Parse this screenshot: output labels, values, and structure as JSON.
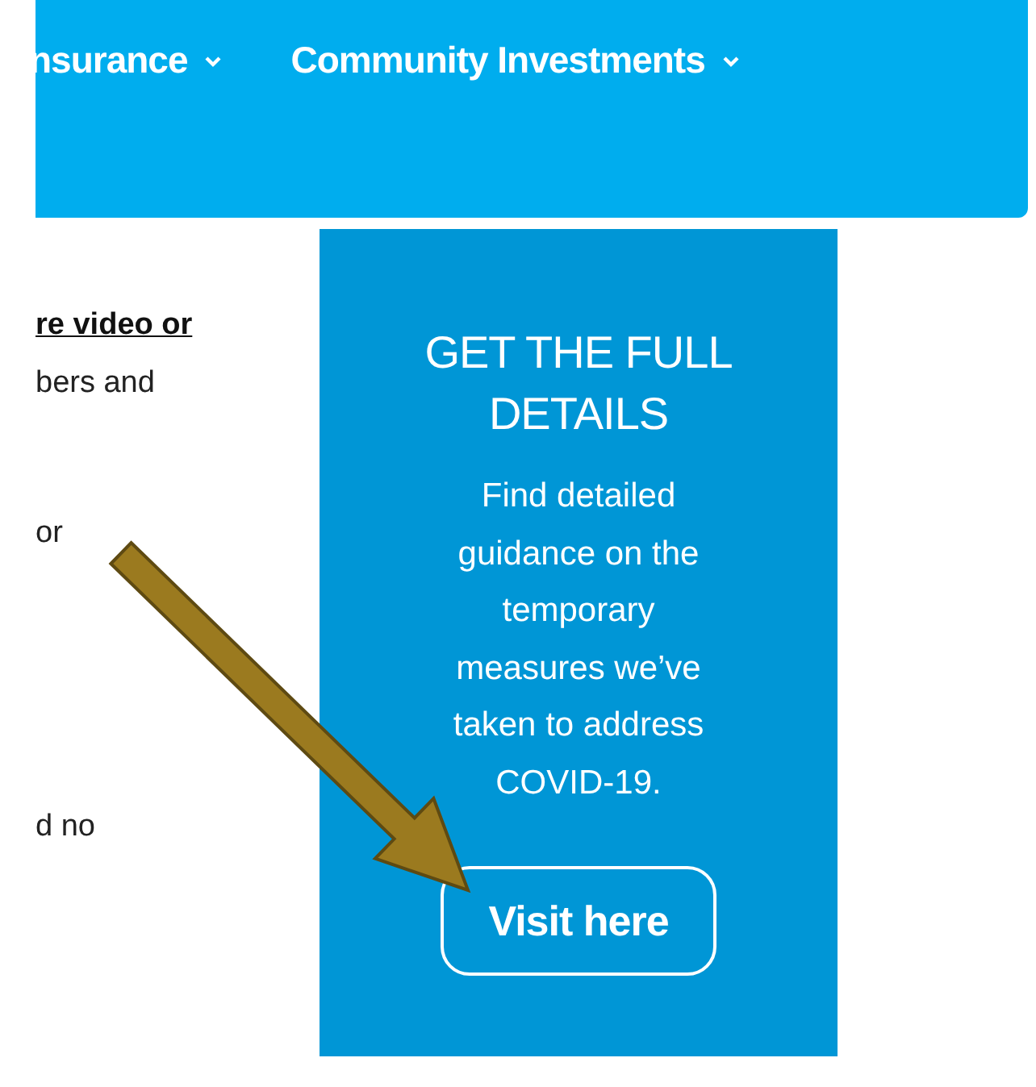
{
  "nav": [
    {
      "label": "nsurance",
      "dropdown": true
    },
    {
      "label": "Community Investments",
      "dropdown": true
    }
  ],
  "body_text": [
    {
      "kind": "link",
      "text": "re video or"
    },
    {
      "kind": "text",
      "text": "bers and"
    },
    {
      "kind": "text",
      "text": "or"
    },
    {
      "kind": "text",
      "text": "d no"
    }
  ],
  "card": {
    "title": "GET THE FULL DETAILS",
    "text": "Find detailed guidance on the temporary measures we’ve taken to address COVID-19.",
    "button": "Visit here"
  }
}
